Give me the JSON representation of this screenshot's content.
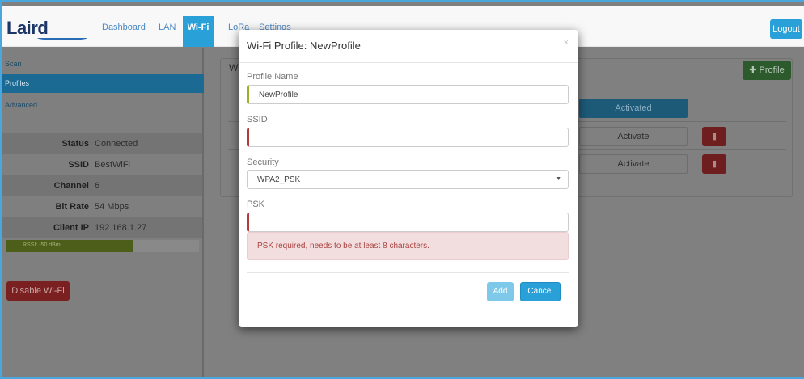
{
  "brand": {
    "logo_text": "Laird"
  },
  "nav": {
    "items": [
      {
        "label": "Dashboard"
      },
      {
        "label": "LAN"
      },
      {
        "label": "Wi-Fi"
      },
      {
        "label": "LoRa"
      },
      {
        "label": "Settings"
      }
    ],
    "active": "Wi-Fi",
    "logout_label": "Logout"
  },
  "sidebar": {
    "links": [
      {
        "label": "Scan"
      },
      {
        "label": "Profiles"
      },
      {
        "label": "Advanced"
      }
    ],
    "active": "Profiles",
    "info": [
      {
        "key": "Status",
        "value": "Connected"
      },
      {
        "key": "SSID",
        "value": "BestWiFi"
      },
      {
        "key": "Channel",
        "value": "6"
      },
      {
        "key": "Bit Rate",
        "value": "54 Mbps"
      },
      {
        "key": "Client IP",
        "value": "192.168.1.27"
      }
    ],
    "rssi": {
      "label": "RSSI: -50 dBm",
      "fraction": 0.66
    },
    "disable_label": "Disable Wi-Fi"
  },
  "main": {
    "panel_title_partial": "W",
    "add_profile_label": "Profile",
    "add_icon": "plus-icon",
    "rows": [
      {
        "action": "Activated",
        "state": "active"
      },
      {
        "action": "Activate",
        "state": "inactive"
      },
      {
        "action": "Activate",
        "state": "inactive"
      }
    ],
    "delete_icon": "trash-icon"
  },
  "modal": {
    "title": "Wi-Fi Profile: NewProfile",
    "close_glyph": "×",
    "profile_name": {
      "label": "Profile Name",
      "value": "NewProfile"
    },
    "ssid": {
      "label": "SSID",
      "value": ""
    },
    "security": {
      "label": "Security",
      "value": "WPA2_PSK"
    },
    "psk": {
      "label": "PSK",
      "value": ""
    },
    "error": "PSK required, needs to be at least 8 characters.",
    "add_label": "Add",
    "cancel_label": "Cancel"
  },
  "colors": {
    "accent": "#2aa0d8",
    "valid_border": "#9cb126",
    "invalid_border": "#b53a3a",
    "danger": "#d9534f",
    "success": "#5cb85c",
    "alert_bg": "#f2dede"
  }
}
